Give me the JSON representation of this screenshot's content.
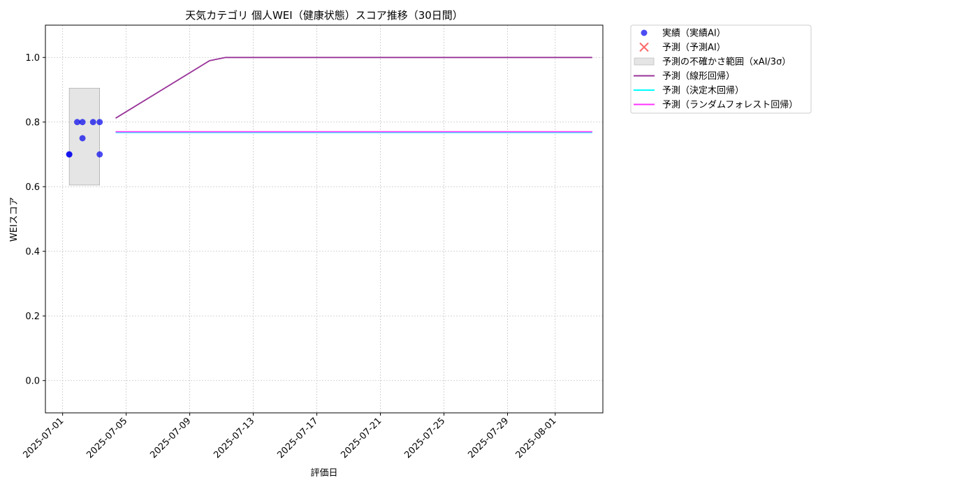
{
  "chart_data": {
    "type": "line",
    "title": "天気カテゴリ 個人WEI（健康状態）スコア推移（30日間）",
    "xlabel": "評価日",
    "ylabel": "WEIスコア",
    "xlim": [
      "2025-06-29T22:00",
      "2025-08-04T00:00"
    ],
    "ylim": [
      -0.1,
      1.1
    ],
    "yticks": [
      0.0,
      0.2,
      0.4,
      0.6,
      0.8,
      1.0
    ],
    "ytick_labels": [
      "0.0",
      "0.2",
      "0.4",
      "0.6",
      "0.8",
      "1.0"
    ],
    "xticks": [
      "2025-07-01",
      "2025-07-05",
      "2025-07-09",
      "2025-07-13",
      "2025-07-17",
      "2025-07-21",
      "2025-07-25",
      "2025-07-29",
      "2025-08-01"
    ],
    "grid": true,
    "legend_position": "outside-upper-right",
    "uncertainty_band": {
      "name": "予測の不確かさ範囲（xAI/3σ）",
      "x": [
        "2025-07-01T10:00",
        "2025-07-03T08:00"
      ],
      "y": [
        0.605,
        0.905
      ],
      "color": "#d3d3d3"
    },
    "actual": {
      "name": "実績（実績AI）",
      "color": "#0000ee",
      "points": [
        {
          "x": "2025-07-01T10:00",
          "y": 0.7
        },
        {
          "x": "2025-07-01T10:00",
          "y": 0.7
        },
        {
          "x": "2025-07-01T22:00",
          "y": 0.8
        },
        {
          "x": "2025-07-02T06:00",
          "y": 0.8
        },
        {
          "x": "2025-07-02T06:00",
          "y": 0.75
        },
        {
          "x": "2025-07-02T22:00",
          "y": 0.8
        },
        {
          "x": "2025-07-03T08:00",
          "y": 0.8
        },
        {
          "x": "2025-07-03T08:00",
          "y": 0.7
        }
      ]
    },
    "predicted_ai": {
      "name": "予測（予測AI）",
      "color": "#ff4444",
      "points": []
    },
    "series": [
      {
        "name": "予測（線形回帰）",
        "color": "#993399",
        "points": [
          {
            "x": "2025-07-04T08:00",
            "y": 0.812
          },
          {
            "x": "2025-07-10T06:00",
            "y": 0.99
          },
          {
            "x": "2025-07-11T06:00",
            "y": 1.0
          },
          {
            "x": "2025-08-03T08:00",
            "y": 1.0
          }
        ]
      },
      {
        "name": "予測（決定木回帰）",
        "color": "#00ffff",
        "points": [
          {
            "x": "2025-07-04T08:00",
            "y": 0.768
          },
          {
            "x": "2025-08-03T08:00",
            "y": 0.768
          }
        ]
      },
      {
        "name": "予測（ランダムフォレスト回帰）",
        "color": "#ff33ff",
        "points": [
          {
            "x": "2025-07-04T08:00",
            "y": 0.77
          },
          {
            "x": "2025-08-03T08:00",
            "y": 0.77
          }
        ]
      }
    ]
  }
}
